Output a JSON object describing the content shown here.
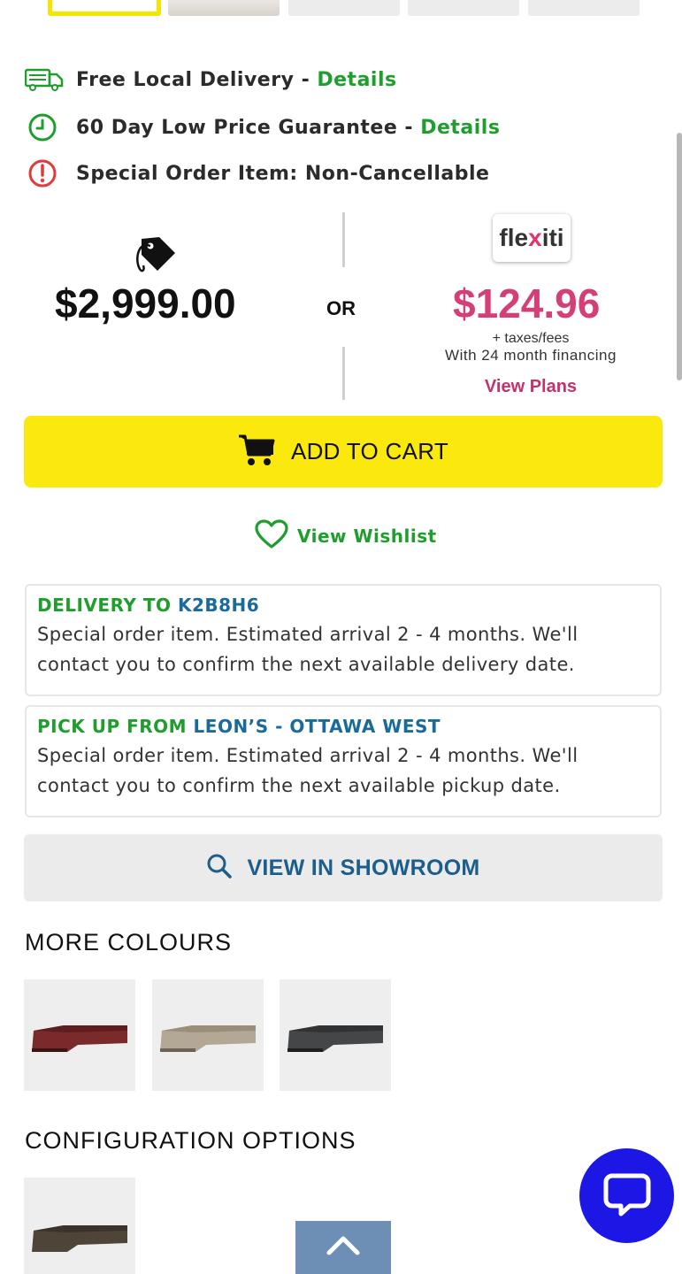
{
  "info_rows": [
    {
      "text": "Free Local Delivery",
      "separator": " - ",
      "link": "Details",
      "icon": "delivery-truck-icon"
    },
    {
      "text": "60 Day Low Price Guarantee",
      "separator": " - ",
      "link": "Details",
      "icon": "clock-icon"
    },
    {
      "text": "Special Order Item: Non-Cancellable",
      "icon": "alert-icon"
    }
  ],
  "pricing": {
    "price": "$2,999.00",
    "or_label": "OR",
    "finance_brand": "flexiti",
    "finance_price": "$124.96",
    "taxes_note": "+ taxes/fees",
    "financing_note": "With 24 month financing",
    "view_plans": "View Plans"
  },
  "cart": {
    "label": "ADD TO CART"
  },
  "wishlist": {
    "label": "View Wishlist"
  },
  "delivery_card": {
    "lead": "DELIVERY TO ",
    "location": "K2B8H6",
    "body": "Special order item. Estimated arrival 2 - 4 months. We'll contact you to confirm the next available delivery date."
  },
  "pickup_card": {
    "lead": "PICK UP FROM ",
    "location": "LEON’S - OTTAWA WEST",
    "body": "Special order item. Estimated arrival 2 - 4 months. We'll contact you to confirm the next available pickup date."
  },
  "showroom": {
    "label": "VIEW IN SHOWROOM"
  },
  "more_colours": {
    "heading": "MORE COLOURS",
    "swatches": [
      {
        "name": "red-sectional",
        "color": "#7a2a2a"
      },
      {
        "name": "beige-sectional",
        "color": "#b3a896"
      },
      {
        "name": "charcoal-sectional",
        "color": "#444648"
      }
    ]
  },
  "configuration": {
    "heading": "CONFIGURATION OPTIONS",
    "swatches": [
      {
        "name": "brown-sectional",
        "color": "#4f4438"
      }
    ]
  },
  "colors": {
    "accent_yellow": "#fbe90d",
    "link_green": "#1f9e2e",
    "finance_pink": "#d43f78",
    "location_blue": "#1b6b9a",
    "chat_blue": "#1c17e4"
  }
}
